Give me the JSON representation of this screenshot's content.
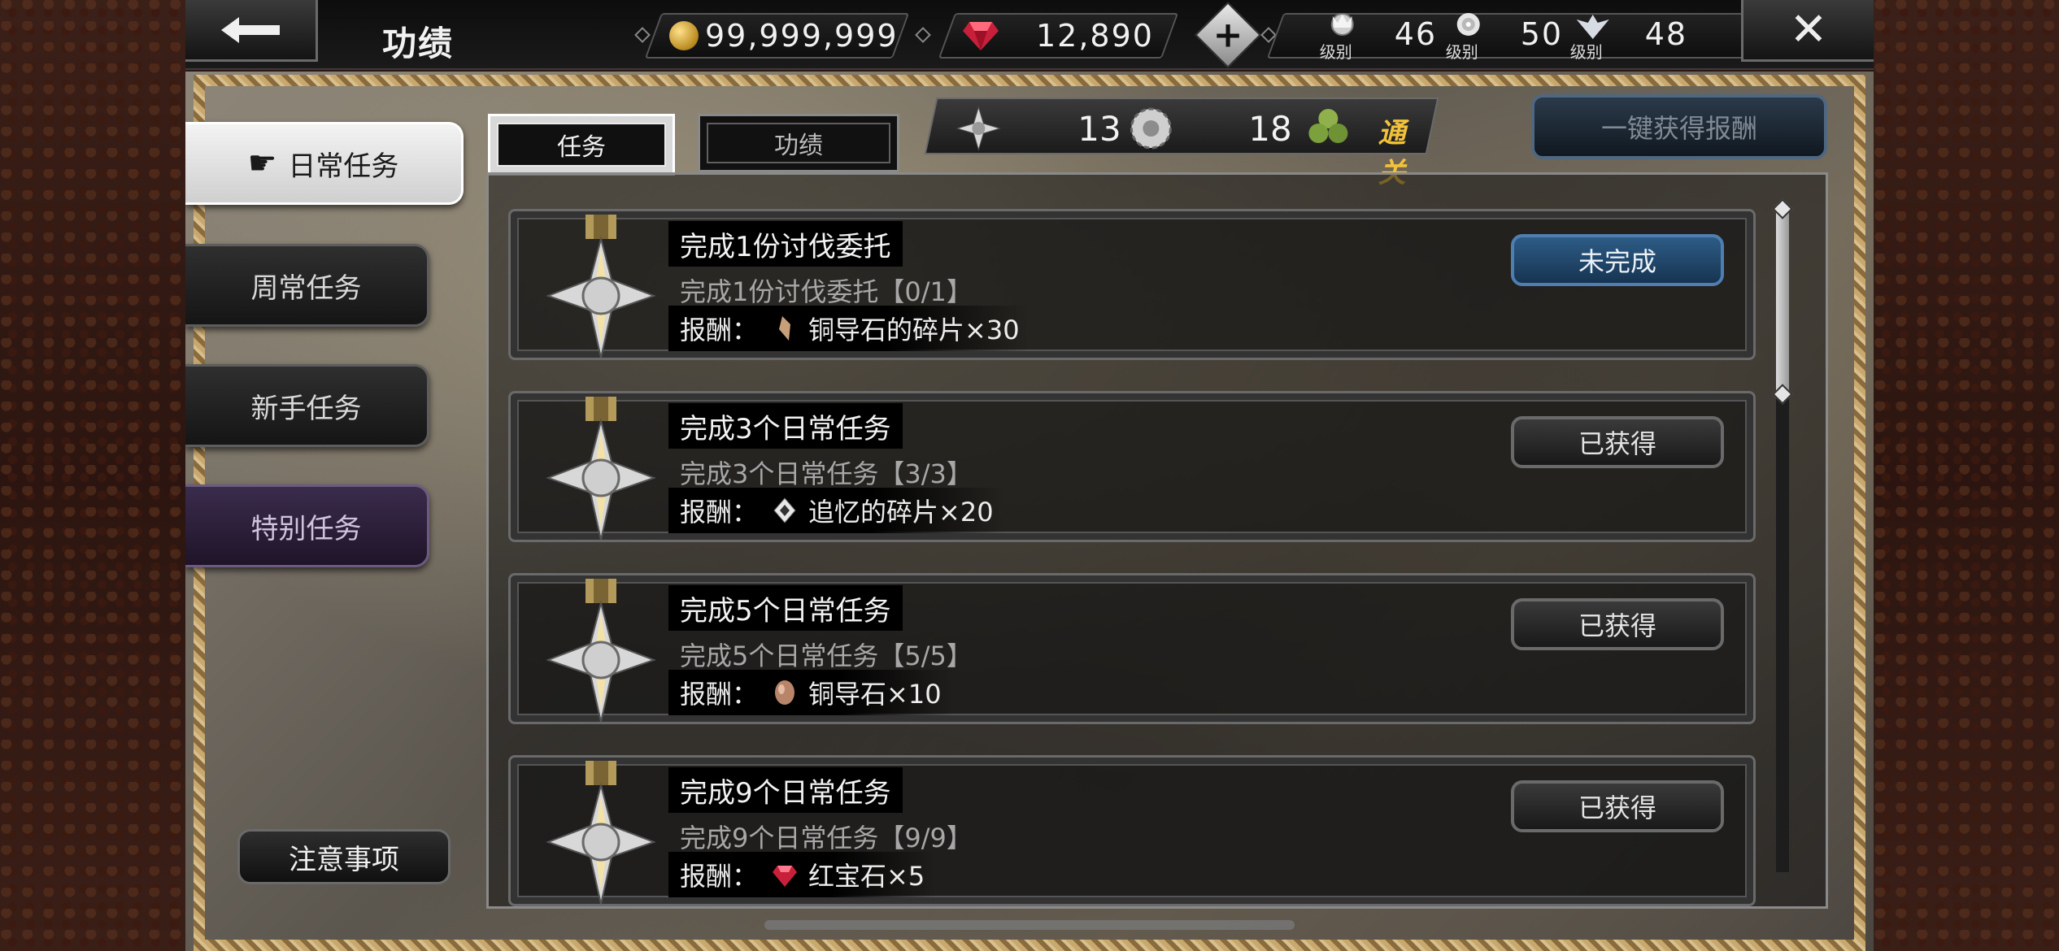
{
  "header": {
    "title": "功绩",
    "gold": "99,999,999",
    "gems": "12,890",
    "add": "+",
    "ranks": [
      {
        "label": "级别",
        "value": "46"
      },
      {
        "label": "级别",
        "value": "50"
      },
      {
        "label": "级别",
        "value": "48"
      }
    ],
    "close": "✕"
  },
  "nav": {
    "items": [
      {
        "label": "日常任务",
        "active": true
      },
      {
        "label": "周常任务",
        "active": false
      },
      {
        "label": "新手任务",
        "active": false
      },
      {
        "label": "特别任务",
        "active": false
      }
    ],
    "notes": "注意事项"
  },
  "tabs": [
    {
      "label": "任务",
      "active": true
    },
    {
      "label": "功绩",
      "active": false
    }
  ],
  "summary": {
    "count1": "13",
    "count2": "18",
    "clear_label": "通关"
  },
  "claim_all": "一键获得报酬",
  "tasks": [
    {
      "name": "完成1份讨伐委托",
      "desc": "完成1份讨伐委托【0/1】",
      "reward_label": "报酬：",
      "reward_item": "铜导石的碎片×30",
      "reward_icon": "shard-icon",
      "status": "未完成"
    },
    {
      "name": "完成3个日常任务",
      "desc": "完成3个日常任务【3/3】",
      "reward_label": "报酬：",
      "reward_item": "追忆的碎片×20",
      "reward_icon": "memory-shard-icon",
      "status": "已获得"
    },
    {
      "name": "完成5个日常任务",
      "desc": "完成5个日常任务【5/5】",
      "reward_label": "报酬：",
      "reward_item": "铜导石×10",
      "reward_icon": "copper-stone-icon",
      "status": "已获得"
    },
    {
      "name": "完成9个日常任务",
      "desc": "完成9个日常任务【9/9】",
      "reward_label": "报酬：",
      "reward_item": "红宝石×5",
      "reward_icon": "ruby-icon",
      "status": "已获得"
    }
  ],
  "colors": {
    "incomplete_btn": "#2d5c86",
    "clear_gold": "#f2c23a",
    "special_nav": "#3a2c4c"
  }
}
